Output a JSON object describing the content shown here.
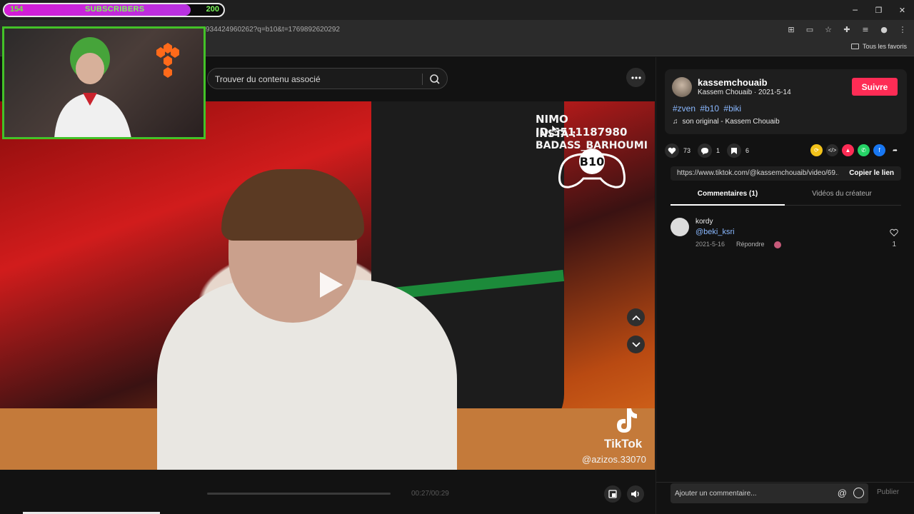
{
  "sub_counter": {
    "min": "154",
    "label": "SUBSCRIBERS",
    "max": "200",
    "progress": 0.85
  },
  "browser": {
    "url_fragment": "934424960262?q=b10&t=1769892620292",
    "favorites_label": "Tous les favoris",
    "window_controls": [
      "─",
      "❐",
      "✕"
    ]
  },
  "search": {
    "placeholder": "Trouver du contenu associé"
  },
  "video": {
    "overlay_id": "NIMO ID:5511187980",
    "overlay_insta": "INSTA : BADASS_BARHOUMI",
    "watermark": "TikTok",
    "handle": "@azizos.33070",
    "time": "00:27/00:29",
    "progress": 0.93
  },
  "author": {
    "handle": "kassemchouaib",
    "meta": "Kassem Chouaib · 2021-5-14",
    "follow_label": "Suivre",
    "hashtags": [
      "#zven",
      "#b10",
      "#biki"
    ],
    "music": "son original - Kassem Chouaib"
  },
  "stats": {
    "likes": "73",
    "comments": "1",
    "saves": "6"
  },
  "share_icons": [
    {
      "name": "repost-icon",
      "color": "#f2c21a"
    },
    {
      "name": "embed-icon",
      "color": "#2b2b2b"
    },
    {
      "name": "send-icon",
      "color": "#fe2c55"
    },
    {
      "name": "whatsapp-icon",
      "color": "#25d366"
    },
    {
      "name": "facebook-icon",
      "color": "#1877f2"
    },
    {
      "name": "share-arrow-icon",
      "color": "#121212"
    }
  ],
  "link": {
    "url": "https://www.tiktok.com/@kassemchouaib/video/69...",
    "copy_label": "Copier le lien"
  },
  "tabs": {
    "comments": "Commentaires (1)",
    "creator_videos": "Vidéos du créateur"
  },
  "comment": {
    "user": "kordy",
    "text": "@beki_ksri",
    "date": "2021-5-16",
    "reply": "Répondre",
    "likes": "1"
  },
  "comment_input": {
    "placeholder": "Ajouter un commentaire...",
    "at_symbol": "@",
    "publish_label": "Publier"
  },
  "colors": {
    "accent": "#fe2c55",
    "link": "#8ab8ff",
    "sub_fill": "#d41bd6",
    "sub_text": "#7cf85a"
  }
}
